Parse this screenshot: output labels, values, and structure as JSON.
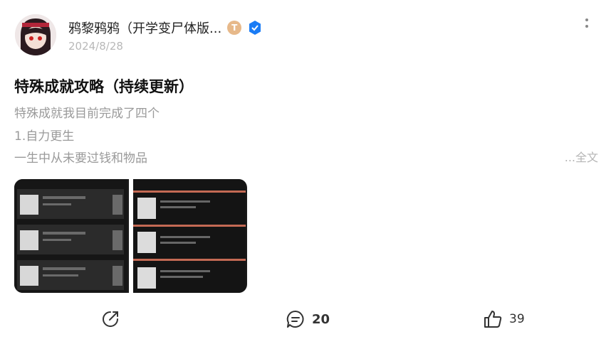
{
  "post": {
    "author": "鸦黎鸦鸦（开学变尸体版...",
    "badge_letter": "T",
    "date": "2024/8/28",
    "title": "特殊成就攻略（持续更新）",
    "lines": [
      "特殊成就我目前完成了四个",
      "1.自力更生",
      "一生中从未要过钱和物品"
    ],
    "more_label": "...全文"
  },
  "actions": {
    "comments": "20",
    "likes": "39"
  },
  "colors": {
    "verified": "#1a7cf5",
    "badge": "#e7b98a"
  }
}
